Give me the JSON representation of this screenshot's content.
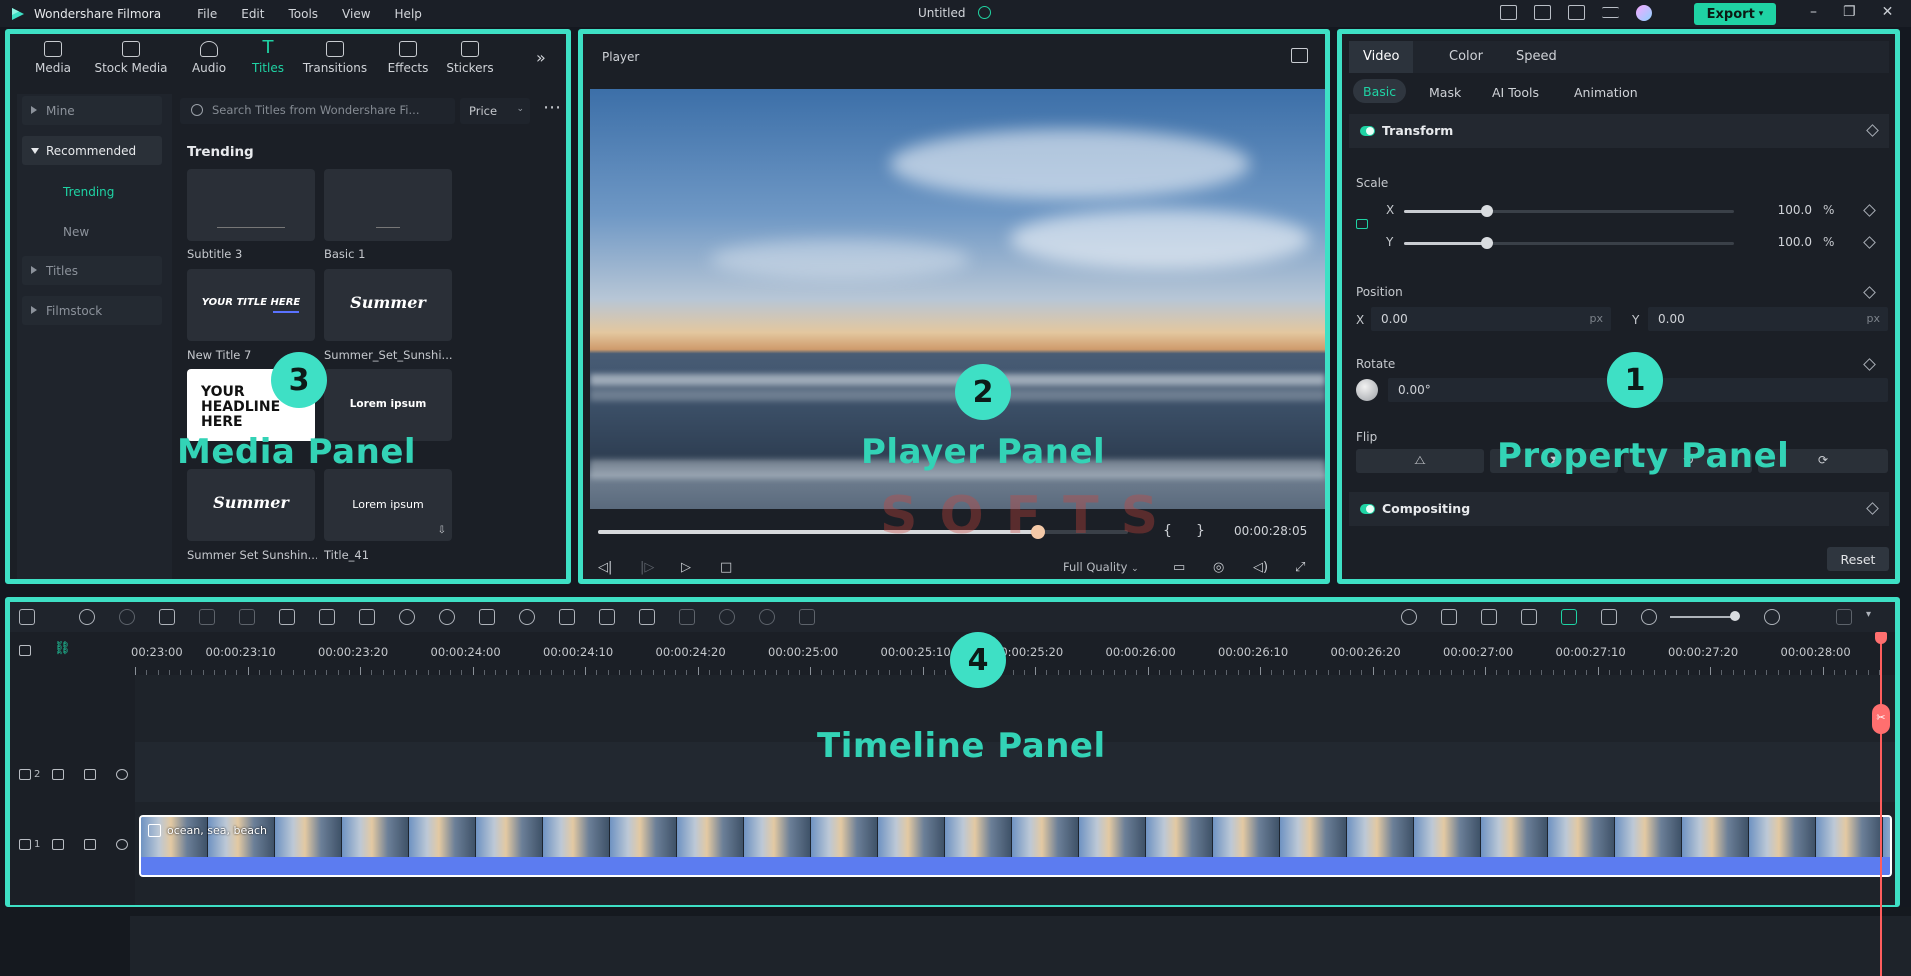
{
  "titlebar": {
    "app_name": "Wondershare Filmora",
    "menu": [
      "File",
      "Edit",
      "Tools",
      "View",
      "Help"
    ],
    "doc_title": "Untitled",
    "export_label": "Export",
    "window_controls": [
      "–",
      "❐",
      "✕"
    ]
  },
  "media": {
    "tabs": [
      {
        "label": "Media",
        "icon": "media-icon"
      },
      {
        "label": "Stock Media",
        "icon": "stock-media-icon"
      },
      {
        "label": "Audio",
        "icon": "audio-icon"
      },
      {
        "label": "Titles",
        "icon": "titles-icon",
        "active": true
      },
      {
        "label": "Transitions",
        "icon": "transitions-icon"
      },
      {
        "label": "Effects",
        "icon": "effects-icon"
      },
      {
        "label": "Stickers",
        "icon": "stickers-icon"
      }
    ],
    "sidebar": {
      "mine": "Mine",
      "recommended": "Recommended",
      "trending": "Trending",
      "new": "New",
      "titles": "Titles",
      "filmstock": "Filmstock"
    },
    "search_placeholder": "Search Titles from Wondershare Fi...",
    "price_label": "Price",
    "section_title": "Trending",
    "thumbs": {
      "subtitle3": "Subtitle 3",
      "basic1": "Basic 1",
      "newtitle7": "New Title 7",
      "newtitle7_text": "YOUR TITLE HERE",
      "summer_set_sunshi": "Summer_Set_Sunshi...",
      "summer_text": "Summer",
      "headline_text": "YOUR HEADLINE HERE",
      "lorem_text": "Lorem ipsum",
      "summer_set_sunshin": "Summer Set Sunshin...",
      "title41": "Title_41",
      "lorem_text2": "Lorem ipsum"
    },
    "overlay_label": "Media Panel",
    "badge": "3"
  },
  "player": {
    "title": "Player",
    "timecode": "00:00:28:05",
    "progress": 0.83,
    "quality": "Full Quality",
    "overlay_label": "Player Panel",
    "badge": "2"
  },
  "property": {
    "tabs": [
      "Video",
      "Color",
      "Speed"
    ],
    "subtabs": [
      "Basic",
      "Mask",
      "AI Tools",
      "Animation"
    ],
    "transform_title": "Transform",
    "scale_label": "Scale",
    "scale_x_label": "X",
    "scale_y_label": "Y",
    "scale_x": "100.0",
    "scale_y": "100.0",
    "scale_level": 0.25,
    "percent": "%",
    "position_label": "Position",
    "pos_x_label": "X",
    "pos_y_label": "Y",
    "pos_x": "0.00",
    "pos_y": "0.00",
    "px": "px",
    "rotate_label": "Rotate",
    "rotate_value": "0.00°",
    "flip_label": "Flip",
    "compositing_title": "Compositing",
    "reset_label": "Reset",
    "overlay_label": "Property Panel",
    "badge": "1"
  },
  "timeline": {
    "ruler": [
      "00:23:00",
      "00:00:23:10",
      "00:00:23:20",
      "00:00:24:00",
      "00:00:24:10",
      "00:00:24:20",
      "00:00:25:00",
      "00:00:25:10",
      "00:00:25:20",
      "00:00:26:00",
      "00:00:26:10",
      "00:00:26:20",
      "00:00:27:00",
      "00:00:27:10",
      "00:00:27:20",
      "00:00:28:00"
    ],
    "track2_num": "2",
    "track1_num": "1",
    "clip_name": "ocean, sea, beach",
    "overlay_label": "Timeline Panel",
    "badge": "4"
  },
  "watermark": {
    "word1": "SOFTS"
  },
  "colors": {
    "accent": "#1fd3a4",
    "frame": "#3ee0c5",
    "playhead": "#ff5e5e"
  }
}
